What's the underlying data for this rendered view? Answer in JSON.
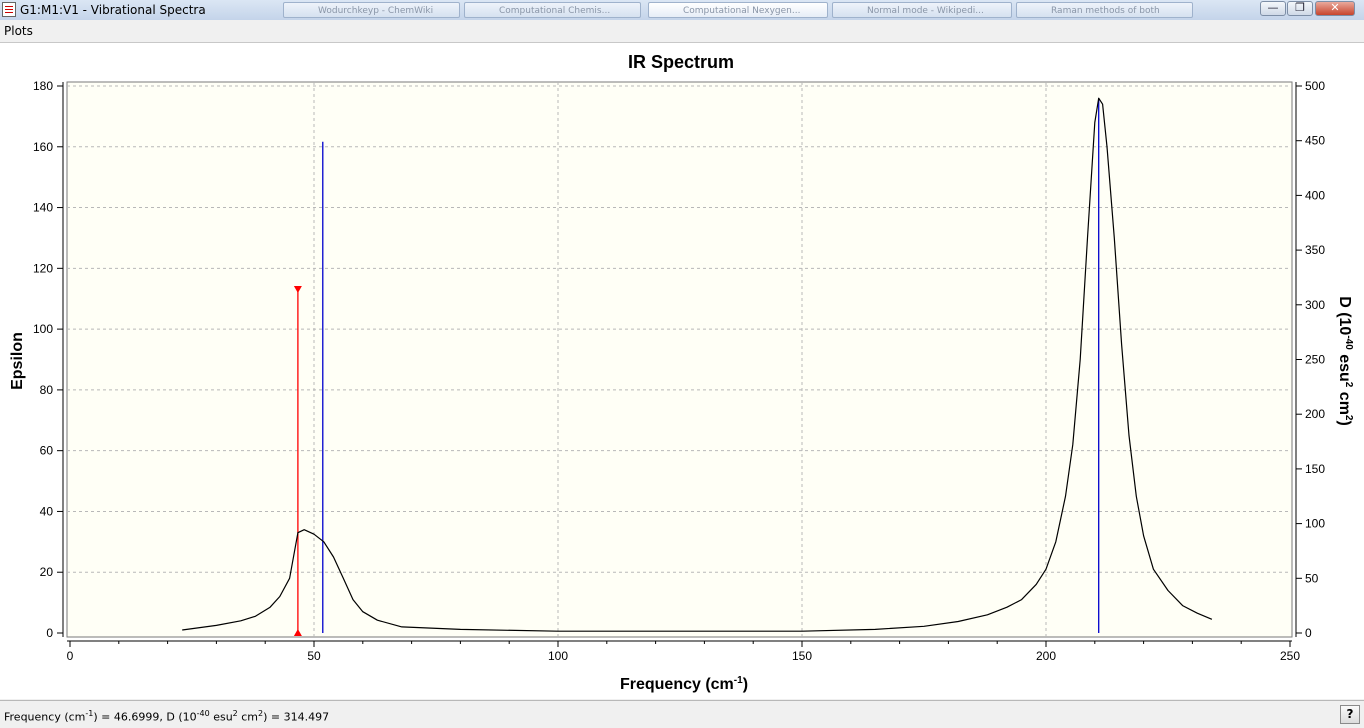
{
  "window": {
    "title": "G1:M1:V1 - Vibrational Spectra",
    "taskbar_tabs": [
      {
        "label": "Wodurchkeyp - ChemWiki"
      },
      {
        "label": "Computational Chemis..."
      },
      {
        "label": "Computational Nexygen..."
      },
      {
        "label": "Normal mode - Wikipedi..."
      },
      {
        "label": "Raman methods of both"
      }
    ],
    "controls": {
      "minimize": "—",
      "maximize": "❐",
      "close": "✕"
    }
  },
  "menu": {
    "plots": "Plots"
  },
  "status": {
    "freq_prefix": "Frequency (cm",
    "freq_sup": "-1",
    "freq_mid": ") = 46.6999, D (10",
    "d_sup": "-40",
    "d_unit1": " esu",
    "d_sup2": "2",
    "d_unit2": " cm",
    "d_sup3": "2",
    "d_suffix": ") = 314.497",
    "help": "?"
  },
  "colors": {
    "plot_bg": "#fffff6",
    "curve": "#000000",
    "stick": "#0000cc",
    "cursor": "#ff0000",
    "grid": "#b8b8b8"
  },
  "chart_data": {
    "type": "line",
    "title": "IR Spectrum",
    "xlabel": "Frequency (cm-1)",
    "ylabel": "Epsilon",
    "y2label": "D (10-40 esu2 cm2)",
    "xlim": [
      0,
      250
    ],
    "ylim": [
      0,
      180
    ],
    "y2lim": [
      0,
      500
    ],
    "x_ticks": [
      0,
      50,
      100,
      150,
      200,
      250
    ],
    "y_ticks": [
      0,
      20,
      40,
      60,
      80,
      100,
      120,
      140,
      160,
      180
    ],
    "y2_ticks": [
      0,
      50,
      100,
      150,
      200,
      250,
      300,
      350,
      400,
      450,
      500
    ],
    "grid": true,
    "spectrum": {
      "x": [
        23,
        30,
        35,
        38,
        41,
        43,
        45,
        46.7,
        48,
        50,
        52,
        54,
        56,
        58,
        60,
        63,
        68,
        80,
        100,
        150,
        165,
        175,
        182,
        188,
        192,
        195,
        198,
        200,
        202,
        204,
        205.5,
        207,
        208.5,
        210,
        210.8,
        211.6,
        212.5,
        214,
        215.5,
        217,
        218.5,
        220,
        222,
        225,
        228,
        231,
        234
      ],
      "y": [
        1,
        2.5,
        4,
        5.5,
        8.5,
        12,
        18,
        33,
        34,
        32.5,
        30,
        25,
        18,
        11,
        7,
        4.2,
        2,
        1.2,
        0.6,
        0.6,
        1.2,
        2.2,
        3.8,
        6,
        8.5,
        11,
        16,
        21,
        30,
        45,
        62,
        90,
        130,
        168,
        176,
        174,
        160,
        130,
        95,
        65,
        45,
        32,
        21,
        14,
        9,
        6.5,
        4.5
      ]
    },
    "sticks": [
      {
        "x": 46.7,
        "d": 314.497,
        "color": "#ff0000",
        "cursor": true
      },
      {
        "x": 51.8,
        "d": 449
      },
      {
        "x": 210.8,
        "d": 489
      }
    ]
  }
}
